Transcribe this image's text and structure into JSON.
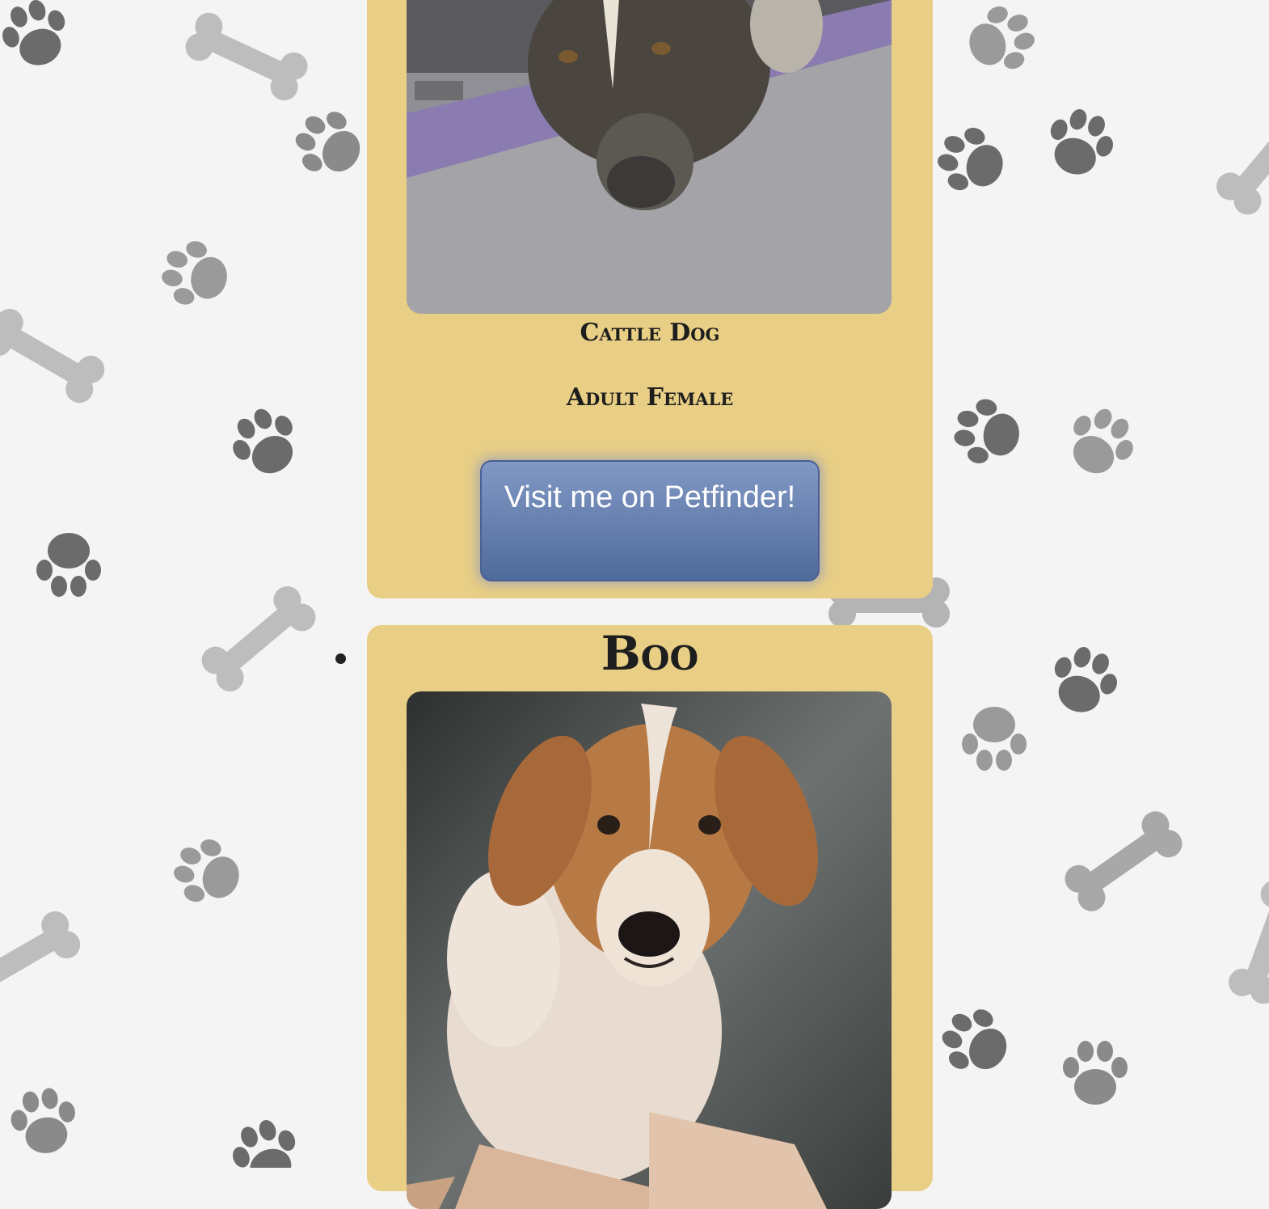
{
  "pets": [
    {
      "breed": "Cattle Dog",
      "age_sex": "Adult Female",
      "button_label": "Visit me on Petfinder!"
    },
    {
      "name": "Boo"
    }
  ],
  "colors": {
    "background": "#f4f4f4",
    "card": "#e9cf85",
    "button_top": "#8198c4",
    "button_bottom": "#4f6b9b",
    "text": "#1e1e1e"
  },
  "icons": [
    "paw-print-icon",
    "bone-icon",
    "list-bullet-icon"
  ]
}
